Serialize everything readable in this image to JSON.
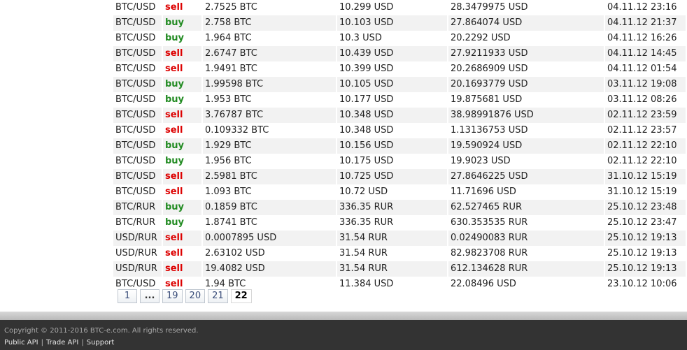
{
  "trades": [
    {
      "pair": "BTC/USD",
      "type": "sell",
      "amount": "2.7525 BTC",
      "price": "10.299 USD",
      "total": "28.3479975 USD",
      "date": "04.11.12 23:16"
    },
    {
      "pair": "BTC/USD",
      "type": "buy",
      "amount": "2.758 BTC",
      "price": "10.103 USD",
      "total": "27.864074 USD",
      "date": "04.11.12 21:37"
    },
    {
      "pair": "BTC/USD",
      "type": "buy",
      "amount": "1.964 BTC",
      "price": "10.3 USD",
      "total": "20.2292 USD",
      "date": "04.11.12 16:26"
    },
    {
      "pair": "BTC/USD",
      "type": "sell",
      "amount": "2.6747 BTC",
      "price": "10.439 USD",
      "total": "27.9211933 USD",
      "date": "04.11.12 14:45"
    },
    {
      "pair": "BTC/USD",
      "type": "sell",
      "amount": "1.9491 BTC",
      "price": "10.399 USD",
      "total": "20.2686909 USD",
      "date": "04.11.12 01:54"
    },
    {
      "pair": "BTC/USD",
      "type": "buy",
      "amount": "1.99598 BTC",
      "price": "10.105 USD",
      "total": "20.1693779 USD",
      "date": "03.11.12 19:08"
    },
    {
      "pair": "BTC/USD",
      "type": "buy",
      "amount": "1.953 BTC",
      "price": "10.177 USD",
      "total": "19.875681 USD",
      "date": "03.11.12 08:26"
    },
    {
      "pair": "BTC/USD",
      "type": "sell",
      "amount": "3.76787 BTC",
      "price": "10.348 USD",
      "total": "38.98991876 USD",
      "date": "02.11.12 23:59"
    },
    {
      "pair": "BTC/USD",
      "type": "sell",
      "amount": "0.109332 BTC",
      "price": "10.348 USD",
      "total": "1.13136753 USD",
      "date": "02.11.12 23:57"
    },
    {
      "pair": "BTC/USD",
      "type": "buy",
      "amount": "1.929 BTC",
      "price": "10.156 USD",
      "total": "19.590924 USD",
      "date": "02.11.12 22:10"
    },
    {
      "pair": "BTC/USD",
      "type": "buy",
      "amount": "1.956 BTC",
      "price": "10.175 USD",
      "total": "19.9023 USD",
      "date": "02.11.12 22:10"
    },
    {
      "pair": "BTC/USD",
      "type": "sell",
      "amount": "2.5981 BTC",
      "price": "10.725 USD",
      "total": "27.8646225 USD",
      "date": "31.10.12 15:19"
    },
    {
      "pair": "BTC/USD",
      "type": "sell",
      "amount": "1.093 BTC",
      "price": "10.72 USD",
      "total": "11.71696 USD",
      "date": "31.10.12 15:19"
    },
    {
      "pair": "BTC/RUR",
      "type": "buy",
      "amount": "0.1859 BTC",
      "price": "336.35 RUR",
      "total": "62.527465 RUR",
      "date": "25.10.12 23:48"
    },
    {
      "pair": "BTC/RUR",
      "type": "buy",
      "amount": "1.8741 BTC",
      "price": "336.35 RUR",
      "total": "630.353535 RUR",
      "date": "25.10.12 23:47"
    },
    {
      "pair": "USD/RUR",
      "type": "sell",
      "amount": "0.0007895 USD",
      "price": "31.54 RUR",
      "total": "0.02490083 RUR",
      "date": "25.10.12 19:13"
    },
    {
      "pair": "USD/RUR",
      "type": "sell",
      "amount": "2.63102 USD",
      "price": "31.54 RUR",
      "total": "82.9823708 RUR",
      "date": "25.10.12 19:13"
    },
    {
      "pair": "USD/RUR",
      "type": "sell",
      "amount": "19.4082 USD",
      "price": "31.54 RUR",
      "total": "612.134628 RUR",
      "date": "25.10.12 19:13"
    },
    {
      "pair": "BTC/USD",
      "type": "sell",
      "amount": "1.94 BTC",
      "price": "11.384 USD",
      "total": "22.08496 USD",
      "date": "23.10.12 10:06"
    }
  ],
  "pagination": {
    "pages": [
      "1",
      "...",
      "19",
      "20",
      "21",
      "22"
    ],
    "current": "22"
  },
  "footer": {
    "copyright": "Copyright © 2011-2016 BTC-e.com. All rights reserved.",
    "links": [
      "Public API",
      "Trade API",
      "Support"
    ],
    "separator": "|"
  },
  "colors": {
    "sell": "#dd0000",
    "buy": "#228b22",
    "footer_bg": "#333333"
  }
}
